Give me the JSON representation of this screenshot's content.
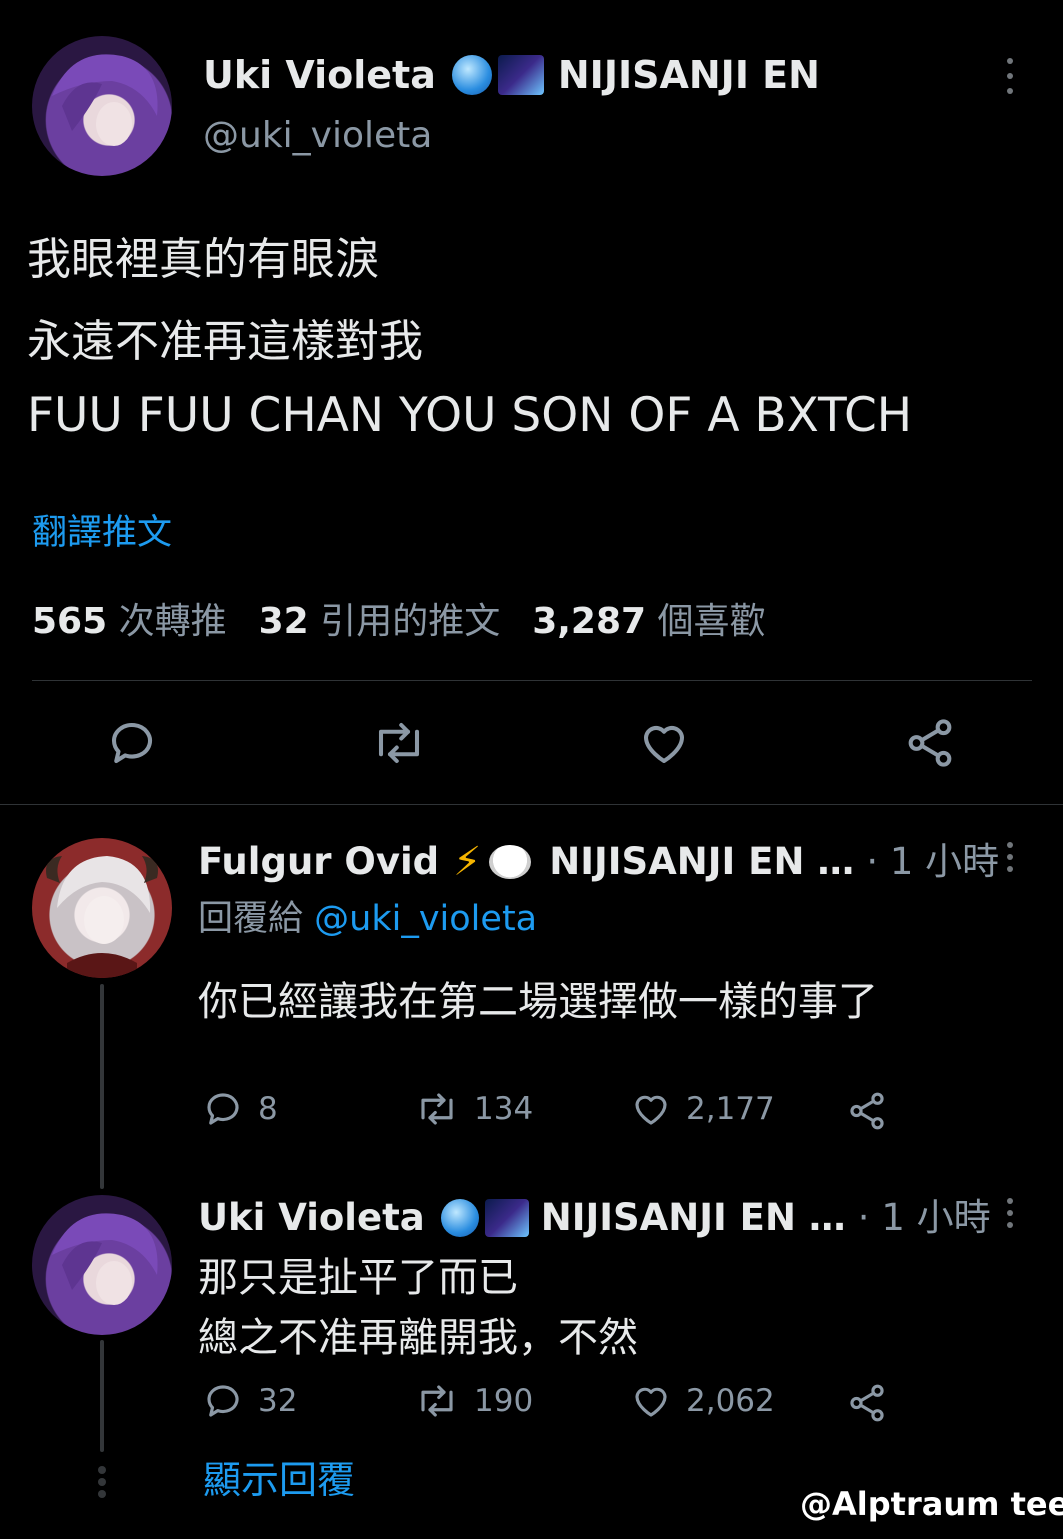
{
  "main_tweet": {
    "display_name": "Uki Violeta",
    "affiliation": "NIJISANJI EN",
    "handle": "@uki_violeta",
    "lines": [
      "我眼裡真的有眼淚",
      "永遠不准再這樣對我",
      "FUU FUU CHAN YOU SON OF A BXTCH"
    ],
    "translate_label": "翻譯推文",
    "stats": {
      "retweets": "565",
      "retweets_label": "次轉推",
      "quotes": "32",
      "quotes_label": "引用的推文",
      "likes": "3,287",
      "likes_label": "個喜歡"
    },
    "badges": [
      "crystal-ball-emoji",
      "galaxy-emoji"
    ]
  },
  "reply_1": {
    "display_name": "Fulgur Ovid",
    "affiliation": "NIJISANJI EN …",
    "time": "· 1 小時",
    "reply_to_label": "回覆給",
    "reply_to_handle": "@uki_violeta",
    "text": "你已經讓我在第二場選擇做一樣的事了",
    "counts": {
      "replies": "8",
      "retweets": "134",
      "likes": "2,177"
    },
    "badges": [
      "lightning-emoji",
      "sheep-emoji"
    ]
  },
  "reply_2": {
    "display_name": "Uki Violeta",
    "affiliation": "NIJISANJI EN …",
    "time": "· 1 小時",
    "lines": [
      "那只是扯平了而已",
      "總之不准再離開我，不然"
    ],
    "counts": {
      "replies": "32",
      "retweets": "190",
      "likes": "2,062"
    },
    "badges": [
      "crystal-ball-emoji",
      "galaxy-emoji"
    ]
  },
  "show_replies_label": "顯示回覆",
  "watermark": "@Alptraum tee",
  "colors": {
    "background": "#000000",
    "text": "#e7e9ea",
    "muted": "#8b98a5",
    "link": "#1d9bf0",
    "divider": "#2f3336"
  }
}
